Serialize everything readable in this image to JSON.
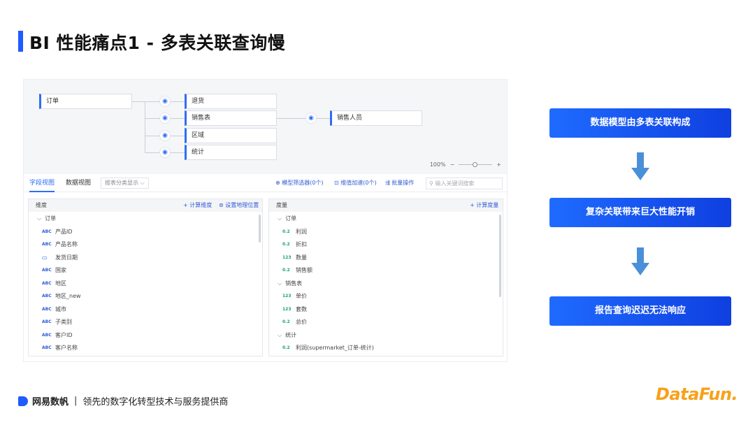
{
  "title": "BI 性能痛点1 - 多表关联查询慢",
  "diagram": {
    "root": "订单",
    "children": [
      "退货",
      "销售表",
      "区域",
      "统计"
    ],
    "grandchild": "销售人员"
  },
  "zoom": {
    "value": "100%",
    "minus": "−",
    "plus": "+"
  },
  "toolbar": {
    "tab_fields": "字段视图",
    "tab_data": "数据视图",
    "select": "按表分类显示 ⌵",
    "model_filter": "⊕ 模型筛选器(0个)",
    "dim_speed": "⊡ 维值加速(0个)",
    "batch": "⇶ 批量操作",
    "search_placeholder": "⚲ 输入关键词搜索"
  },
  "dimension_panel": {
    "header": "维度",
    "add_calc": "+ 计算维度",
    "set_geo": "⊚ 设置地理位置",
    "group": "订单",
    "items": [
      {
        "icon": "ABC",
        "label": "产品ID"
      },
      {
        "icon": "ABC",
        "label": "产品名称"
      },
      {
        "icon": "▭",
        "label": "发货日期"
      },
      {
        "icon": "ABC",
        "label": "国家"
      },
      {
        "icon": "ABC",
        "label": "地区"
      },
      {
        "icon": "ABC",
        "label": "地区_new"
      },
      {
        "icon": "ABC",
        "label": "城市"
      },
      {
        "icon": "ABC",
        "label": "子类别"
      },
      {
        "icon": "ABC",
        "label": "客户ID"
      },
      {
        "icon": "ABC",
        "label": "客户名称"
      }
    ]
  },
  "measure_panel": {
    "header": "度量",
    "add_calc": "+ 计算度量",
    "group1": "订单",
    "items1": [
      {
        "icon": "0.2",
        "label": "利润"
      },
      {
        "icon": "0.2",
        "label": "折扣"
      },
      {
        "icon": "123",
        "label": "数量"
      },
      {
        "icon": "0.2",
        "label": "销售额"
      }
    ],
    "group2": "销售表",
    "items2": [
      {
        "icon": "123",
        "label": "单价"
      },
      {
        "icon": "123",
        "label": "套数"
      },
      {
        "icon": "0.2",
        "label": "总价"
      }
    ],
    "group3": "统计",
    "items3": [
      {
        "icon": "0.2",
        "label": "利润(supermarket_订单-统计)"
      }
    ]
  },
  "flow": [
    "数据模型由多表关联构成",
    "复杂关联带来巨大性能开销",
    "报告查询迟迟无法响应"
  ],
  "footer": {
    "brand": "网易数帆",
    "sep": "|",
    "tagline": "领先的数字化转型技术与服务提供商",
    "logo": "DataFun."
  },
  "colors": {
    "accent": "#1f5bff",
    "flow_box": "#1f6bff",
    "arrow": "#4a90d9",
    "logo": "#f7a11a"
  }
}
